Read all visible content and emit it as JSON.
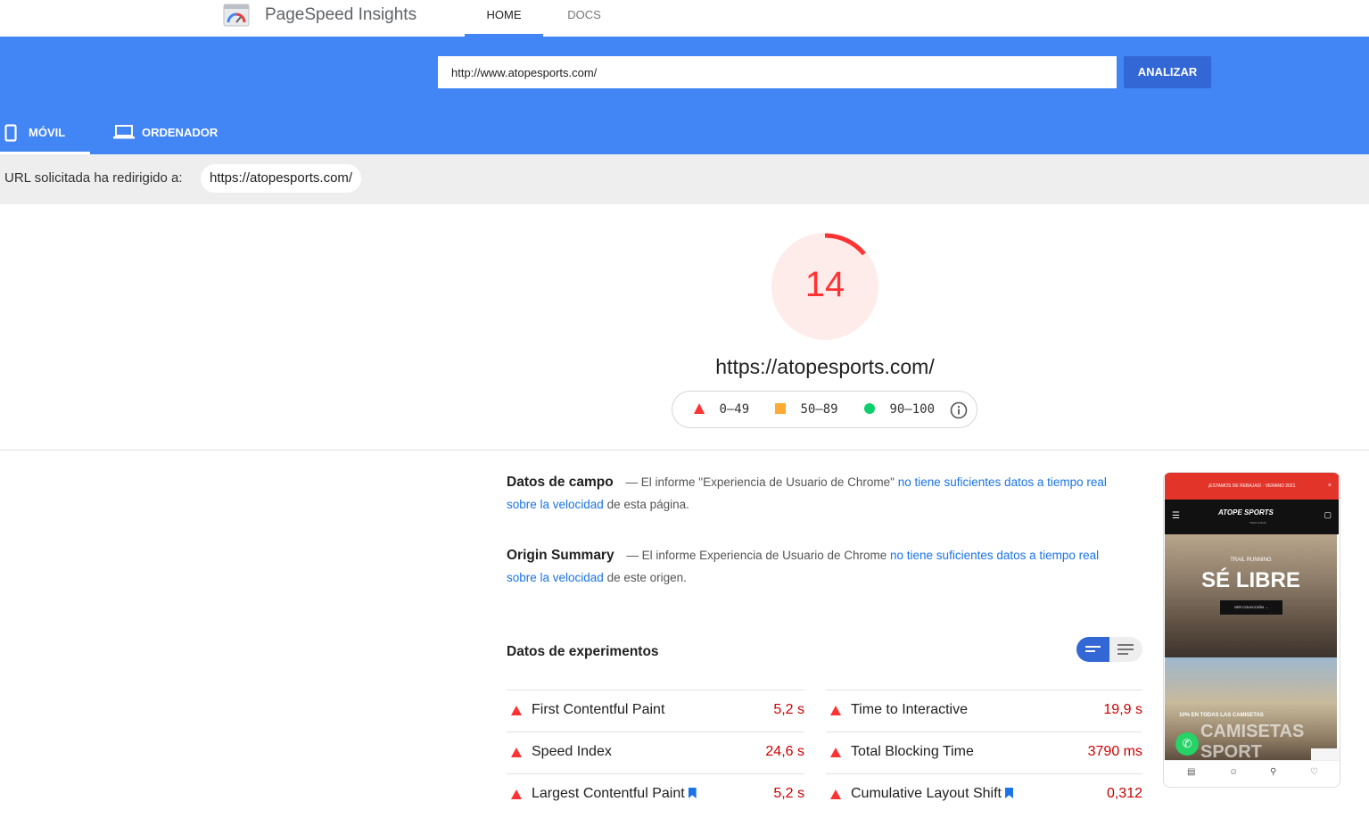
{
  "header": {
    "app_title": "PageSpeed Insights",
    "tabs": [
      {
        "label": "HOME",
        "active": true
      },
      {
        "label": "DOCS",
        "active": false
      }
    ]
  },
  "search": {
    "url_value": "http://www.atopesports.com/",
    "analyze_label": "ANALIZAR"
  },
  "device_tabs": [
    {
      "label": "MÓVIL",
      "icon": "phone-icon",
      "active": true
    },
    {
      "label": "ORDENADOR",
      "icon": "laptop-icon",
      "active": false
    }
  ],
  "redirect": {
    "label": "URL solicitada ha redirigido a:",
    "url": "https://atopesports.com/"
  },
  "score": {
    "value": "14",
    "fraction": 0.14,
    "url": "https://atopesports.com/",
    "color": "#ff3333"
  },
  "legend": [
    {
      "range": "0–49",
      "shape": "triangle",
      "color": "#ff3333"
    },
    {
      "range": "50–89",
      "shape": "square",
      "color": "#ffaa33"
    },
    {
      "range": "90–100",
      "shape": "circle",
      "color": "#0cce6b"
    }
  ],
  "field_data": {
    "title": "Datos de campo",
    "text_before": "— El informe \"Experiencia de Usuario de Chrome\"",
    "link": "no tiene suficientes datos a tiempo real sobre la velocidad",
    "text_after": "de esta página."
  },
  "origin_summary": {
    "title": "Origin Summary",
    "text_before": "— El informe Experiencia de Usuario de Chrome",
    "link": "no tiene suficientes datos a tiempo real sobre la velocidad",
    "text_after": "de este origen."
  },
  "lab": {
    "title": "Datos de experimentos",
    "metrics_left": [
      {
        "label": "First Contentful Paint",
        "value": "5,2 s",
        "bookmark": false
      },
      {
        "label": "Speed Index",
        "value": "24,6 s",
        "bookmark": false
      },
      {
        "label": "Largest Contentful Paint",
        "value": "5,2 s",
        "bookmark": true
      }
    ],
    "metrics_right": [
      {
        "label": "Time to Interactive",
        "value": "19,9 s",
        "bookmark": false
      },
      {
        "label": "Total Blocking Time",
        "value": "3790 ms",
        "bookmark": false
      },
      {
        "label": "Cumulative Layout Shift",
        "value": "0,312",
        "bookmark": true
      }
    ]
  },
  "screenshot": {
    "promo": "¡ESTAMOS DE REBAJAS! · VERANO 2021",
    "close": "×",
    "brand": "ATOPE SPORTS",
    "brand_sub": "TRAIL & RUN",
    "hero_kicker": "TRAIL RUNNING",
    "hero_title": "SÉ LIBRE",
    "hero_button": "VER COLECCIÓN →",
    "promo2": "10% EN TODAS LAS CAMISETAS",
    "promo2_title": "CAMISETAS SPORT"
  }
}
